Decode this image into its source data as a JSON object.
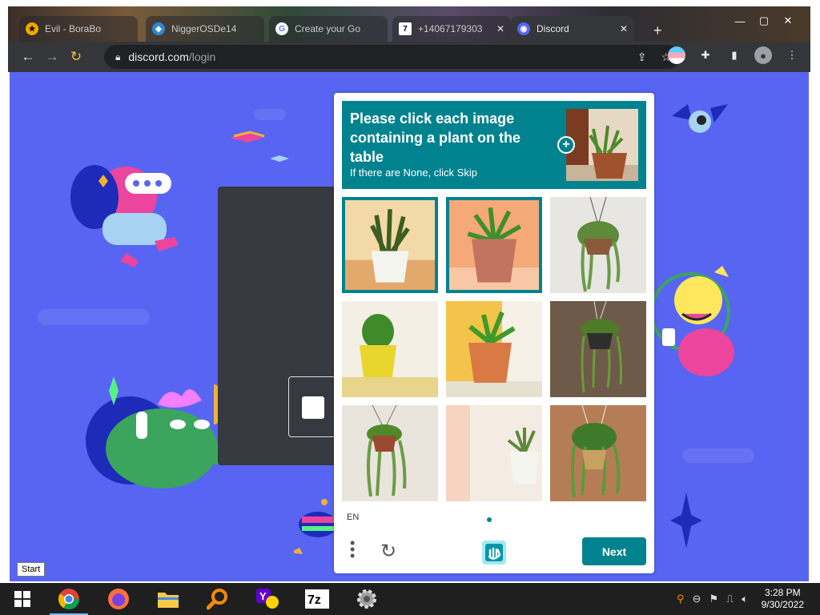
{
  "browser": {
    "tabs": [
      {
        "title": "Evil - BoraBo",
        "active": false,
        "favicon_color": "#f2a900"
      },
      {
        "title": "NiggerOSDe14",
        "active": false,
        "favicon_color": "#2d87d7"
      },
      {
        "title": "Create your Go",
        "active": false,
        "favicon_color": "#ffffff"
      },
      {
        "title": "+14067179303",
        "active": false,
        "favicon_color": "#000000"
      },
      {
        "title": "Discord",
        "active": true,
        "favicon_color": "#5865f2"
      }
    ],
    "new_tab_label": "+",
    "url_host": "discord.com",
    "url_path": "/login"
  },
  "captcha": {
    "question": "Please click each image containing a plant on the table",
    "hint": "If there are None, click Skip",
    "language": "EN",
    "next_label": "Next",
    "tiles": [
      {
        "subject": "snake-plant-white-pot",
        "selected": true
      },
      {
        "subject": "plant-terracotta-pot",
        "selected": true
      },
      {
        "subject": "hanging-plant",
        "selected": false
      },
      {
        "subject": "plant-yellow-pot",
        "selected": false
      },
      {
        "subject": "plant-orange-pot",
        "selected": false
      },
      {
        "subject": "hanging-plant",
        "selected": false
      },
      {
        "subject": "hanging-plant",
        "selected": false
      },
      {
        "subject": "plant-white-pot",
        "selected": false
      },
      {
        "subject": "hanging-plant",
        "selected": false
      }
    ],
    "accent": "#00838f"
  },
  "tooltip": {
    "start": "Start"
  },
  "taskbar": {
    "apps": [
      "windows-start",
      "chrome",
      "firefox",
      "file-explorer",
      "search-magnifier",
      "yahoo-messenger",
      "7zip",
      "settings-gear"
    ],
    "time": "3:28 PM",
    "date": "9/30/2022"
  },
  "colors": {
    "discord_bg": "#5865f2",
    "captcha_teal": "#00838f"
  }
}
